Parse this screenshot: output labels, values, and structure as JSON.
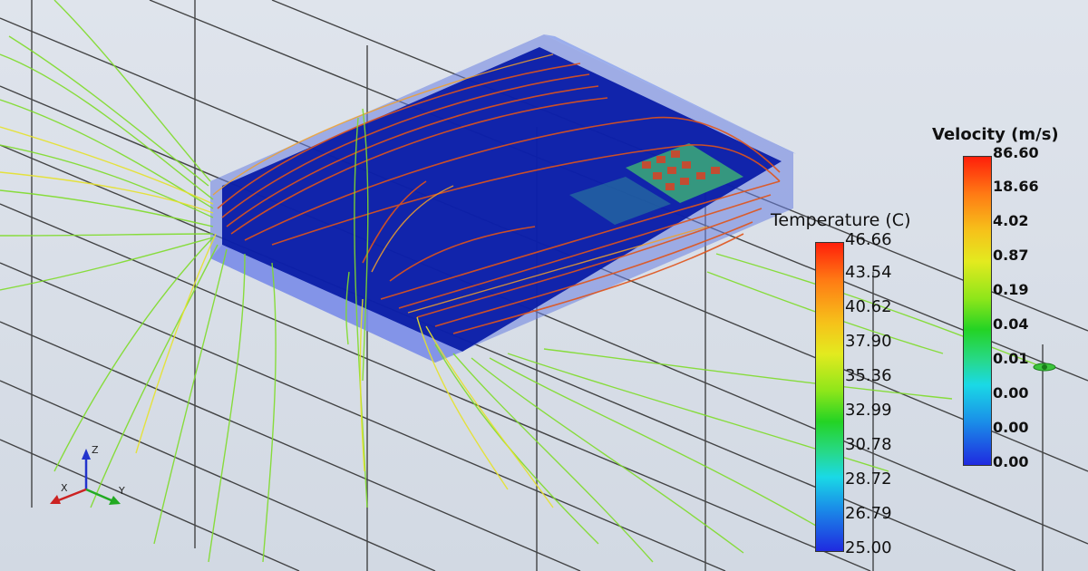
{
  "temperature_legend": {
    "title": "Temperature (C)",
    "ticks": [
      "46.66",
      "43.54",
      "40.62",
      "37.90",
      "35.36",
      "32.99",
      "30.78",
      "28.72",
      "26.79",
      "25.00"
    ]
  },
  "velocity_legend": {
    "title": "Velocity (m/s)",
    "ticks": [
      "86.60",
      "18.66",
      "4.02",
      "0.87",
      "0.19",
      "0.04",
      "0.01",
      "0.00",
      "0.00",
      "0.00"
    ]
  },
  "axes": {
    "x": "X",
    "y": "Y",
    "z": "Z"
  },
  "colors": {
    "background": "#d7dde6",
    "enclosure": "#5a6fd8",
    "plate": "#0a1a9e",
    "streamline_hot": "#e0541a",
    "streamline_cool": "#7fdc2a"
  }
}
